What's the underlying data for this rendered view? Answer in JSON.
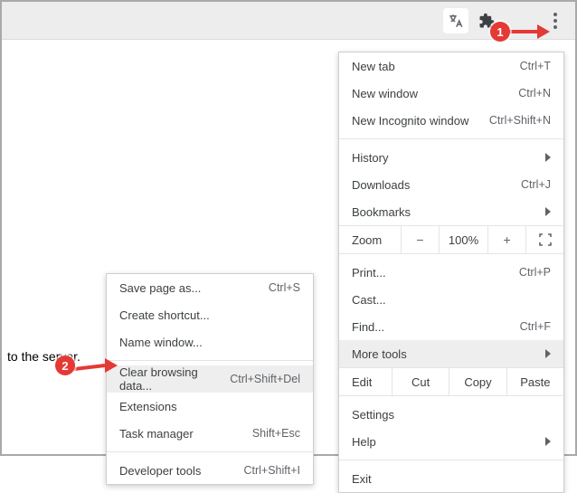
{
  "page": {
    "body_text": "to the server."
  },
  "toolbar": {
    "translate_icon": "translate-icon",
    "extensions_icon": "extensions-icon",
    "kebab_icon": "kebab-icon"
  },
  "menu": {
    "new_tab": {
      "label": "New tab",
      "shortcut": "Ctrl+T"
    },
    "new_window": {
      "label": "New window",
      "shortcut": "Ctrl+N"
    },
    "new_incognito": {
      "label": "New Incognito window",
      "shortcut": "Ctrl+Shift+N"
    },
    "history": {
      "label": "History"
    },
    "downloads": {
      "label": "Downloads",
      "shortcut": "Ctrl+J"
    },
    "bookmarks": {
      "label": "Bookmarks"
    },
    "zoom": {
      "label": "Zoom",
      "minus": "−",
      "value": "100%",
      "plus": "+"
    },
    "print": {
      "label": "Print...",
      "shortcut": "Ctrl+P"
    },
    "cast": {
      "label": "Cast..."
    },
    "find": {
      "label": "Find...",
      "shortcut": "Ctrl+F"
    },
    "more_tools": {
      "label": "More tools"
    },
    "edit": {
      "label": "Edit",
      "cut": "Cut",
      "copy": "Copy",
      "paste": "Paste"
    },
    "settings": {
      "label": "Settings"
    },
    "help": {
      "label": "Help"
    },
    "exit": {
      "label": "Exit"
    }
  },
  "more_tools_menu": {
    "save_page": {
      "label": "Save page as...",
      "shortcut": "Ctrl+S"
    },
    "create_shortcut": {
      "label": "Create shortcut..."
    },
    "name_window": {
      "label": "Name window..."
    },
    "clear_browsing": {
      "label": "Clear browsing data...",
      "shortcut": "Ctrl+Shift+Del"
    },
    "extensions": {
      "label": "Extensions"
    },
    "task_manager": {
      "label": "Task manager",
      "shortcut": "Shift+Esc"
    },
    "developer_tools": {
      "label": "Developer tools",
      "shortcut": "Ctrl+Shift+I"
    }
  },
  "annotations": {
    "badge1": "1",
    "badge2": "2"
  }
}
